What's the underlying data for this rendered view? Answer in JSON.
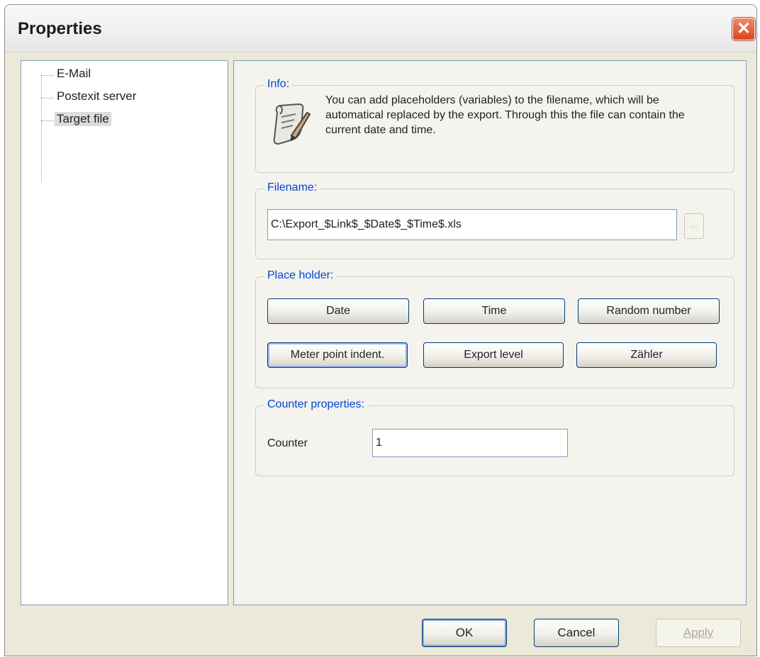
{
  "window": {
    "title": "Properties"
  },
  "tree": {
    "items": [
      {
        "label": "E-Mail",
        "selected": false
      },
      {
        "label": "Postexit server",
        "selected": false
      },
      {
        "label": "Target file",
        "selected": true
      }
    ]
  },
  "info": {
    "label": "Info:",
    "text": "You can add placeholders (variables) to the filename, which will be automatical replaced by the export. Through this the file can contain the current date and time.",
    "icon": "scroll-quill-icon"
  },
  "filename": {
    "label": "Filename:",
    "value": "C:\\Export_$Link$_$Date$_$Time$.xls",
    "browse_label": "..."
  },
  "placeholder": {
    "label": "Place holder:",
    "buttons": [
      "Date",
      "Time",
      "Random number",
      "Meter point indent.",
      "Export level",
      "Zähler"
    ]
  },
  "counter": {
    "label": "Counter properties:",
    "field_label": "Counter",
    "value": "1"
  },
  "footer": {
    "ok": "OK",
    "cancel": "Cancel",
    "apply": "Apply"
  }
}
